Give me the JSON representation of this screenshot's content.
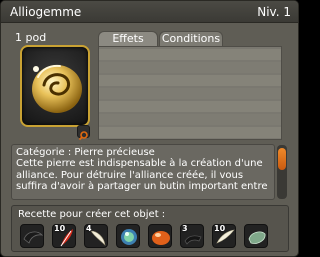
{
  "window": {
    "title": "Alliogemme",
    "level": "Niv. 1"
  },
  "item": {
    "weight": "1 pod",
    "icon": "golden-gem-icon"
  },
  "tabs": [
    {
      "label": "Effets"
    },
    {
      "label": "Conditions"
    }
  ],
  "description": {
    "lines": [
      "Catégorie : Pierre précieuse",
      "Cette pierre est indispensable à la création d'une",
      "alliance. Pour détruire l'alliance créée, il vous",
      "suffira d'avoir à partager un butin important entre"
    ]
  },
  "recipe": {
    "title": "Recette pour créer cet objet :",
    "ingredients": [
      {
        "qty": "",
        "icon": "black-horn-icon"
      },
      {
        "qty": "10",
        "icon": "red-feather-icon"
      },
      {
        "qty": "4",
        "icon": "white-fang-icon"
      },
      {
        "qty": "",
        "icon": "blue-orb-icon"
      },
      {
        "qty": "",
        "icon": "orange-gem-icon"
      },
      {
        "qty": "3",
        "icon": "black-claw-icon"
      },
      {
        "qty": "10",
        "icon": "white-horn-icon"
      },
      {
        "qty": "",
        "icon": "green-stone-icon"
      }
    ]
  },
  "colors": {
    "accent": "#c9a233",
    "scroll_thumb": "#f08a2a",
    "zoom": "#e06a10"
  }
}
